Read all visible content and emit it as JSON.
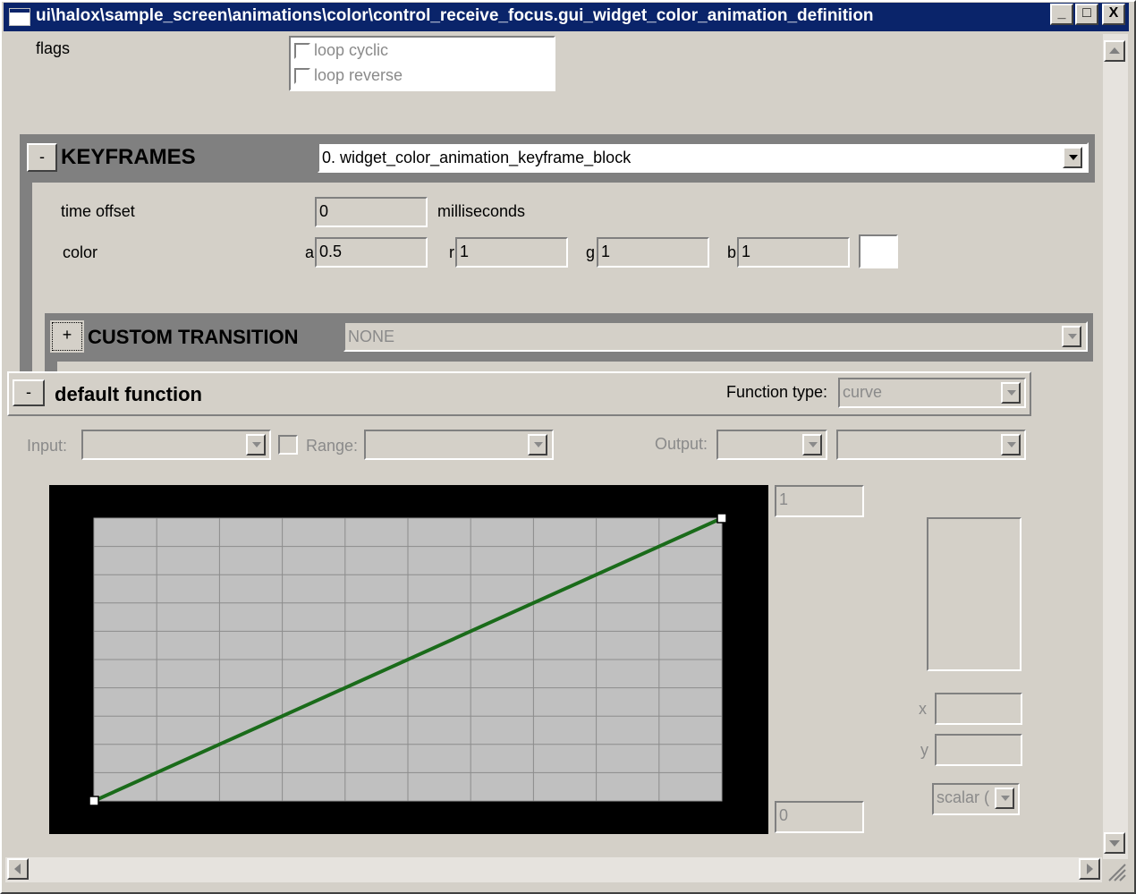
{
  "window": {
    "title": "ui\\halox\\sample_screen\\animations\\color\\control_receive_focus.gui_widget_color_animation_definition",
    "buttons": {
      "minimize": "_",
      "maximize": "□",
      "close": "X"
    }
  },
  "flags": {
    "label": "flags",
    "options": [
      {
        "label": "loop cyclic",
        "checked": false
      },
      {
        "label": "loop reverse",
        "checked": false
      }
    ]
  },
  "keyframes": {
    "toggle": "-",
    "title": "KEYFRAMES",
    "selected_block": "0. widget_color_animation_keyframe_block",
    "time_offset": {
      "label": "time offset",
      "value": "0",
      "unit": "milliseconds"
    },
    "color": {
      "label": "color",
      "a_label": "a",
      "a_value": "0.5",
      "r_label": "r",
      "r_value": "1",
      "g_label": "g",
      "g_value": "1",
      "b_label": "b",
      "b_value": "1",
      "swatch_color": "#ffffff"
    }
  },
  "custom_transition": {
    "toggle": "+",
    "title": "CUSTOM TRANSITION",
    "selected": "NONE"
  },
  "default_function": {
    "toggle": "-",
    "title": "default function",
    "function_type_label": "Function type:",
    "function_type_value": "curve",
    "input_label": "Input:",
    "input_value": "",
    "range_label": "Range:",
    "range_value": "",
    "output_label": "Output:",
    "output_value_1": "",
    "output_value_2": "",
    "graph_max": "1",
    "graph_min": "0",
    "x_label": "x",
    "x_value": "",
    "y_label": "y",
    "y_value": "",
    "scalar_label": "scalar ("
  },
  "chart_data": {
    "type": "line",
    "series": [
      {
        "x": [
          0,
          1
        ],
        "y": [
          0,
          1
        ]
      }
    ],
    "xlim": [
      0,
      1
    ],
    "ylim": [
      0,
      1
    ],
    "grid": true,
    "grid_columns": 10,
    "grid_rows": 10,
    "line_color": "#1a6b1a",
    "background": "#c0c0c0"
  },
  "colors": {
    "title_bar": "#0a246a",
    "face": "#d4d0c8",
    "section_header": "#808080",
    "curve": "#1a6b1a"
  }
}
